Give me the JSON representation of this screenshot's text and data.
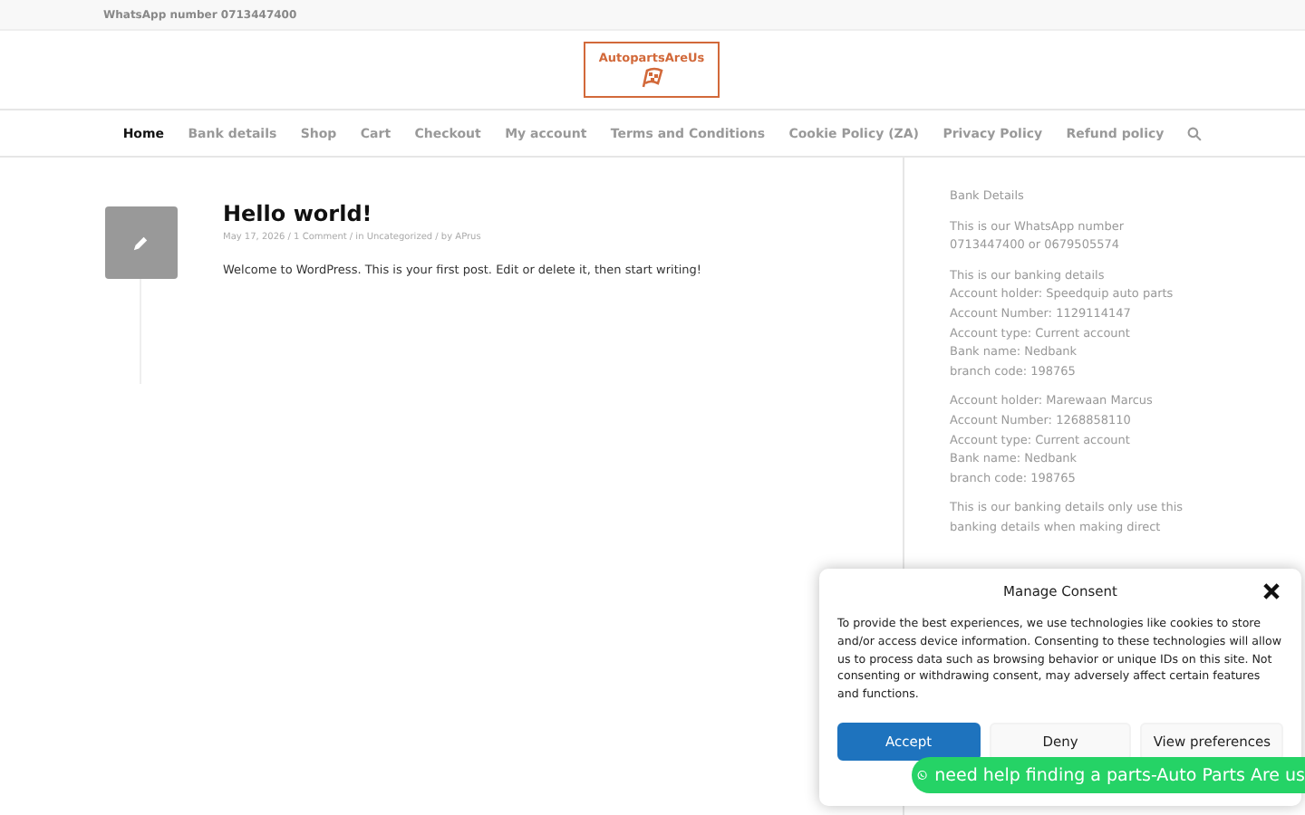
{
  "top_bar": {
    "text": "WhatsApp number 0713447400"
  },
  "logo": {
    "text": "AutopartsAreUs"
  },
  "nav": {
    "items": [
      {
        "label": "Home",
        "selected": true
      },
      {
        "label": "Bank details",
        "selected": false
      },
      {
        "label": "Shop",
        "selected": false
      },
      {
        "label": "Cart",
        "selected": false
      },
      {
        "label": "Checkout",
        "selected": false
      },
      {
        "label": "My account",
        "selected": false
      },
      {
        "label": "Terms and Conditions",
        "selected": false
      },
      {
        "label": "Cookie Policy (ZA)",
        "selected": false
      },
      {
        "label": "Privacy Policy",
        "selected": false
      },
      {
        "label": "Refund policy",
        "selected": false
      }
    ]
  },
  "post": {
    "title": "Hello world!",
    "meta": "May 17, 2026 / 1 Comment / in Uncategorized / by APrus",
    "body": "Welcome to WordPress. This is your first post. Edit or delete it, then start writing!"
  },
  "sidebar": {
    "title": "Bank Details",
    "paragraphs": [
      [
        "This is our WhatsApp number",
        "0713447400 or 0679505574"
      ],
      [
        "This is our banking details",
        "Account holder: Speedquip auto parts",
        "Account Number: 1129114147",
        "Account type: Current account",
        "Bank name: Nedbank",
        "branch code: 198765"
      ],
      [
        "Account holder: Marewaan Marcus",
        "Account Number: 1268858110",
        "Account type: Current account",
        "Bank name: Nedbank",
        "branch code: 198765"
      ],
      [
        "This is our banking details only use this",
        "banking details when making direct"
      ]
    ]
  },
  "consent": {
    "title": "Manage Consent",
    "text": "To provide the best experiences, we use technologies like cookies to store and/or access device information. Consenting to these technologies will allow us to process data such as browsing behavior or unique IDs on this site. Not consenting or withdrawing consent, may adversely affect certain features and functions.",
    "buttons": [
      {
        "label": "Accept",
        "kind": "primary"
      },
      {
        "label": "Deny",
        "kind": "secondary"
      },
      {
        "label": "View preferences",
        "kind": "secondary"
      }
    ]
  },
  "whatsapp_button": {
    "label": "need help finding a parts-Auto Parts Are us"
  }
}
